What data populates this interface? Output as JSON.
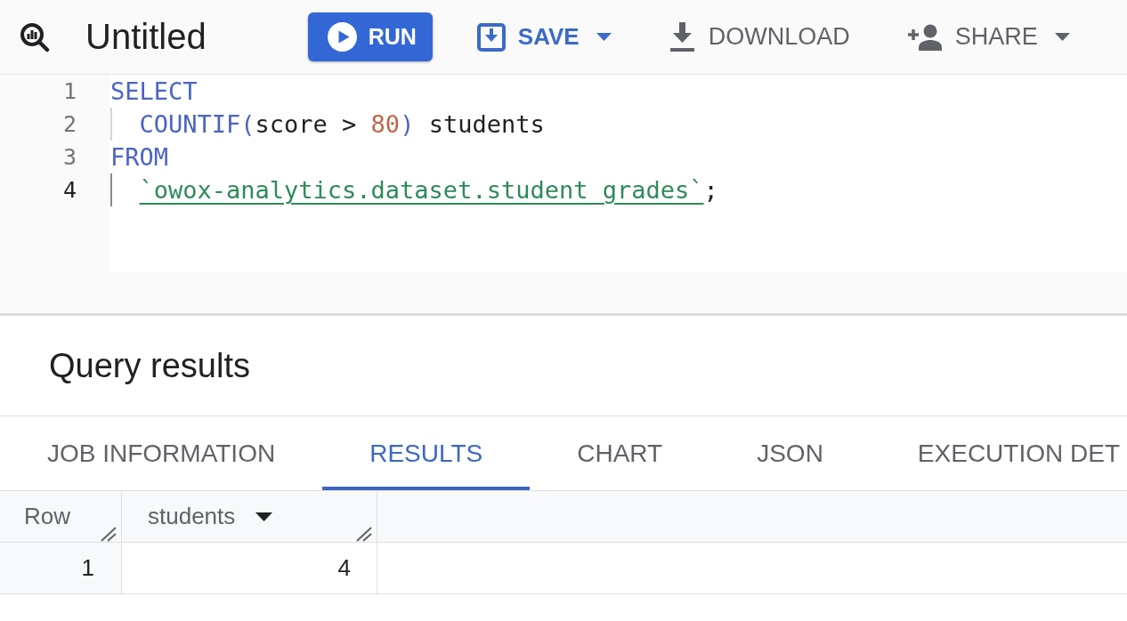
{
  "toolbar": {
    "title": "Untitled",
    "buttons": [
      {
        "label": "RUN",
        "kind": "primary",
        "dropdown": false
      },
      {
        "label": "SAVE",
        "kind": "accent",
        "dropdown": true
      },
      {
        "label": "DOWNLOAD",
        "kind": "plain",
        "dropdown": false
      },
      {
        "label": "SHARE",
        "kind": "plain",
        "dropdown": true
      }
    ]
  },
  "editor": {
    "lines": [
      {
        "number": "1",
        "active": false,
        "indented": false,
        "tokens": [
          {
            "text": "SELECT",
            "kind": "keyword"
          }
        ]
      },
      {
        "number": "2",
        "active": false,
        "indented": true,
        "tokens": [
          {
            "text": "COUNTIF",
            "kind": "keyword"
          },
          {
            "text": "(",
            "kind": "keyword"
          },
          {
            "text": "score > ",
            "kind": "plain"
          },
          {
            "text": "80",
            "kind": "number"
          },
          {
            "text": ")",
            "kind": "keyword"
          },
          {
            "text": " students",
            "kind": "plain"
          }
        ]
      },
      {
        "number": "3",
        "active": false,
        "indented": false,
        "tokens": [
          {
            "text": "FROM",
            "kind": "keyword"
          }
        ]
      },
      {
        "number": "4",
        "active": true,
        "indented": true,
        "tokens": [
          {
            "text": "`owox-analytics.dataset.student_grades`",
            "kind": "table_ref"
          },
          {
            "text": ";",
            "kind": "plain"
          }
        ]
      }
    ]
  },
  "results": {
    "title": "Query results",
    "tabs": [
      {
        "label": "JOB INFORMATION",
        "selected": false
      },
      {
        "label": "RESULTS",
        "selected": true
      },
      {
        "label": "CHART",
        "selected": false
      },
      {
        "label": "JSON",
        "selected": false
      },
      {
        "label": "EXECUTION DET",
        "selected": false
      }
    ],
    "table": {
      "columns": [
        {
          "label": "Row",
          "menu": false
        },
        {
          "label": "students",
          "menu": true
        }
      ],
      "rows": [
        [
          "1",
          "4"
        ]
      ]
    }
  }
}
